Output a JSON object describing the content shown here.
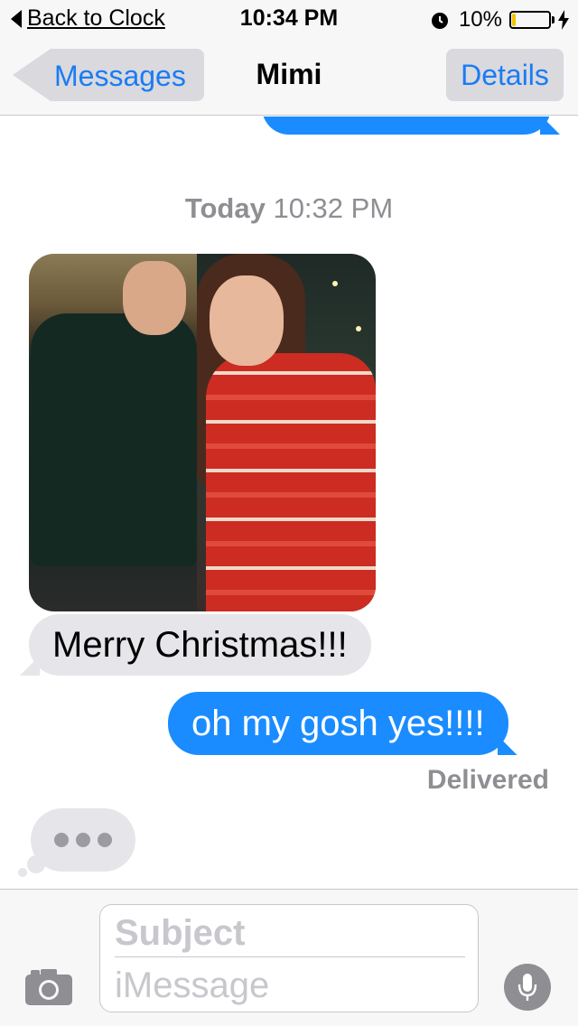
{
  "status_bar": {
    "back_label": "Back to Clock",
    "time": "10:34 PM",
    "battery_percent": "10%",
    "battery_level": 0.1,
    "battery_color": "#f5c200"
  },
  "nav": {
    "back_label": "Messages",
    "title": "Mimi",
    "details_label": "Details"
  },
  "thread": {
    "timestamp_day": "Today",
    "timestamp_time": "10:32 PM",
    "messages": [
      {
        "type": "image",
        "direction": "received"
      },
      {
        "type": "text",
        "direction": "received",
        "text": "Merry Christmas!!!"
      },
      {
        "type": "text",
        "direction": "sent",
        "text": "oh my gosh yes!!!!"
      }
    ],
    "delivered_label": "Delivered",
    "typing_indicator": true
  },
  "compose": {
    "subject_placeholder": "Subject",
    "message_placeholder": "iMessage"
  },
  "colors": {
    "sent_bubble": "#1a8cff",
    "received_bubble": "#e5e5ea",
    "accent": "#1a7cf4"
  },
  "icons": {
    "back_arrow": "back-triangle-icon",
    "alarm": "alarm-clock-icon",
    "charging": "lightning-bolt-icon",
    "camera": "camera-icon",
    "mic": "microphone-icon"
  }
}
